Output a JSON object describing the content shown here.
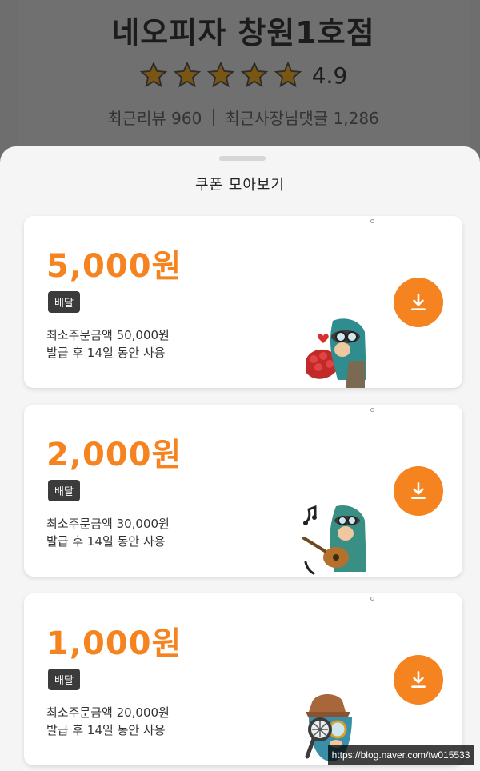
{
  "store": {
    "name": "네오피자 창원1호점",
    "rating": "4.9",
    "stars": 5,
    "recent_reviews": "최근리뷰 960",
    "owner_replies": "최근사장님댓글 1,286"
  },
  "sheet": {
    "title": "쿠폰 모아보기"
  },
  "coupons": [
    {
      "amount": "5,000원",
      "badge": "배달",
      "min_order": "최소주문금액 50,000원",
      "validity": "발급 후 14일 동안 사용",
      "sticker": "heart-bouquet-sticker"
    },
    {
      "amount": "2,000원",
      "badge": "배달",
      "min_order": "최소주문금액 30,000원",
      "validity": "발급 후 14일 동안 사용",
      "sticker": "guitar-sticker"
    },
    {
      "amount": "1,000원",
      "badge": "배달",
      "min_order": "최소주문금액 20,000원",
      "validity": "발급 후 14일 동안 사용",
      "sticker": "magnifier-sticker"
    }
  ],
  "colors": {
    "accent": "#f5831f",
    "badge": "#3b3b3b",
    "star": "#e7a623"
  },
  "watermark": "https://blog.naver.com/tw015533"
}
